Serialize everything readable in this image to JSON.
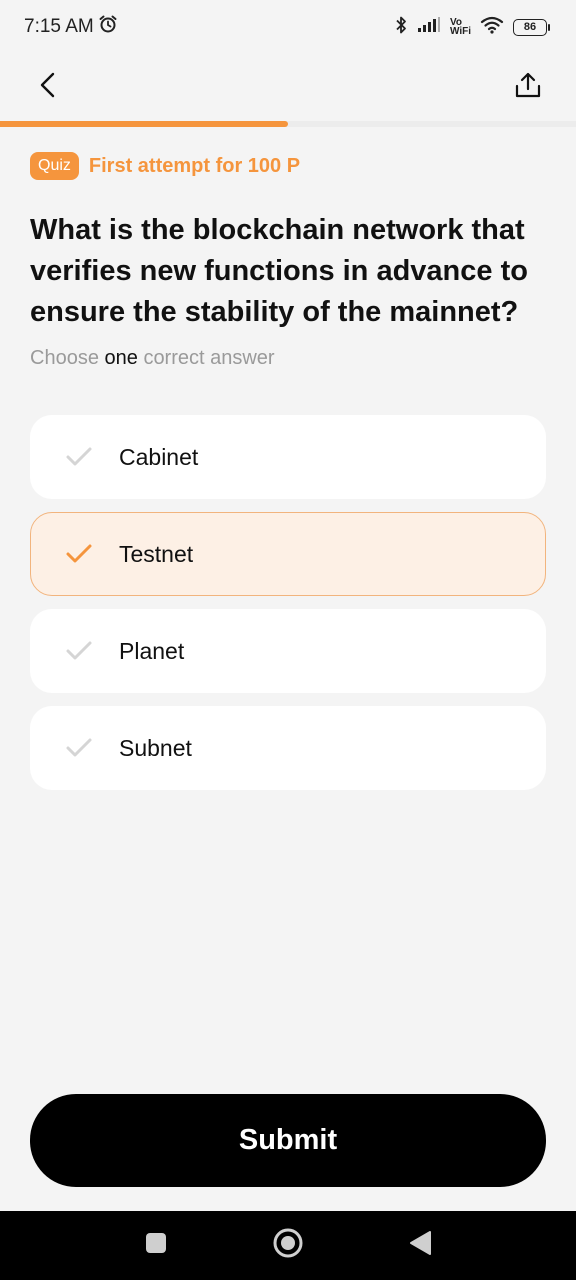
{
  "status_bar": {
    "time": "7:15 AM",
    "vowifi_top": "Vo",
    "vowifi_bottom": "WiFi",
    "battery": "86",
    "icons": [
      "alarm-icon",
      "bluetooth-icon",
      "signal-icon",
      "vowifi-icon",
      "wifi-icon",
      "battery-icon"
    ]
  },
  "top_nav": {
    "back_icon": "chevron-left-icon",
    "share_icon": "share-icon"
  },
  "progress": {
    "value": 0.5,
    "color": "#f5953d"
  },
  "quiz": {
    "badge": "Quiz",
    "reward": "First attempt for 100 P",
    "question": "What is the blockchain network that verifies new functions in advance to ensure the stability of the mainnet?",
    "instruction_prefix": "Choose",
    "instruction_emphasis": "one",
    "instruction_suffix": "correct answer"
  },
  "options": [
    {
      "label": "Cabinet",
      "selected": false
    },
    {
      "label": "Testnet",
      "selected": true
    },
    {
      "label": "Planet",
      "selected": false
    },
    {
      "label": "Subnet",
      "selected": false
    }
  ],
  "submit": {
    "label": "Submit"
  },
  "system_nav": {
    "icons": [
      "recent-apps-icon",
      "home-icon",
      "back-triangle-icon"
    ]
  },
  "colors": {
    "accent": "#f5953d",
    "selected_bg": "#fdf0e5",
    "check_inactive": "#d5d5d5"
  }
}
